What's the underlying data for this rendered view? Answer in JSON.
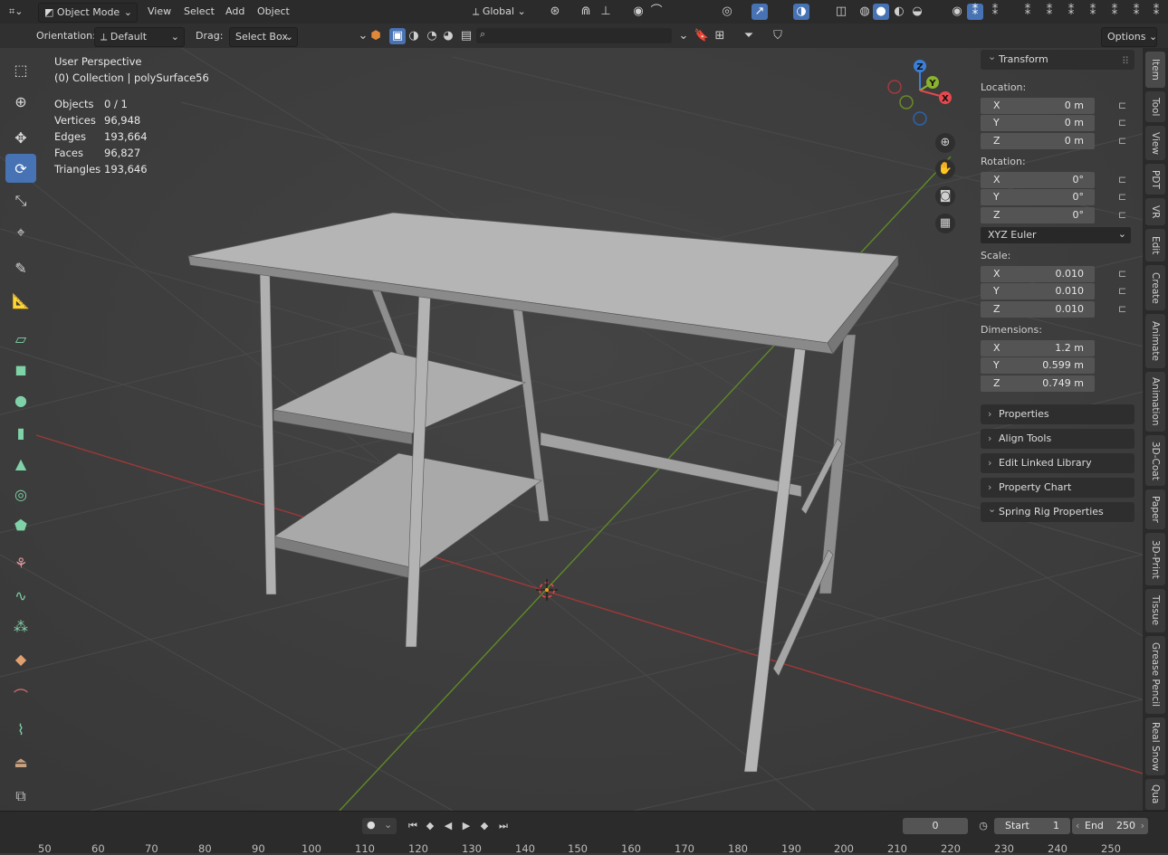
{
  "header": {
    "mode": "Object Mode",
    "menus": [
      "View",
      "Select",
      "Add",
      "Object"
    ],
    "transform_orientation": "Global"
  },
  "tool_settings": {
    "orientation_label": "Orientation:",
    "orientation_value": "Default",
    "drag_label": "Drag:",
    "drag_value": "Select Box",
    "options": "Options"
  },
  "viewport": {
    "view_name": "User Perspective",
    "collection": "(0) Collection | polySurface56",
    "stats": [
      {
        "label": "Objects",
        "value": "0 / 1"
      },
      {
        "label": "Vertices",
        "value": "96,948"
      },
      {
        "label": "Edges",
        "value": "193,664"
      },
      {
        "label": "Faces",
        "value": "96,827"
      },
      {
        "label": "Triangles",
        "value": "193,646"
      }
    ],
    "gizmo": {
      "z": "Z",
      "y": "Y",
      "x": "X"
    }
  },
  "npanel": {
    "transform_title": "Transform",
    "location_label": "Location:",
    "location": [
      {
        "axis": "X",
        "value": "0 m"
      },
      {
        "axis": "Y",
        "value": "0 m"
      },
      {
        "axis": "Z",
        "value": "0 m"
      }
    ],
    "rotation_label": "Rotation:",
    "rotation": [
      {
        "axis": "X",
        "value": "0°"
      },
      {
        "axis": "Y",
        "value": "0°"
      },
      {
        "axis": "Z",
        "value": "0°"
      }
    ],
    "rotation_mode": "XYZ Euler",
    "scale_label": "Scale:",
    "scale": [
      {
        "axis": "X",
        "value": "0.010"
      },
      {
        "axis": "Y",
        "value": "0.010"
      },
      {
        "axis": "Z",
        "value": "0.010"
      }
    ],
    "dimensions_label": "Dimensions:",
    "dimensions": [
      {
        "axis": "X",
        "value": "1.2 m"
      },
      {
        "axis": "Y",
        "value": "0.599 m"
      },
      {
        "axis": "Z",
        "value": "0.749 m"
      }
    ],
    "panels": [
      "Properties",
      "Align Tools",
      "Edit Linked Library",
      "Property Chart",
      "Spring Rig Properties"
    ]
  },
  "sidebar_tabs": [
    "Item",
    "Tool",
    "View",
    "PDT",
    "VR",
    "Edit",
    "Create",
    "Animate",
    "Animation",
    "3D-Coat",
    "Paper",
    "3D-Print",
    "Tissue",
    "Grease Pencil",
    "Real Snow",
    "Qua"
  ],
  "timeline": {
    "current_frame": "0",
    "start_label": "Start",
    "start": "1",
    "end_label": "End",
    "end": "250",
    "ruler": [
      "50",
      "60",
      "70",
      "80",
      "90",
      "100",
      "110",
      "120",
      "130",
      "140",
      "150",
      "160",
      "170",
      "180",
      "190",
      "200",
      "210",
      "220",
      "230",
      "240",
      "250"
    ]
  },
  "colors": {
    "accent": "#4772b3",
    "x_axis": "#c13a3a",
    "y_axis": "#6a9a2b",
    "gizmo_x": "#e5484d",
    "gizmo_y": "#8ab32f",
    "gizmo_z": "#3b7fd6"
  }
}
